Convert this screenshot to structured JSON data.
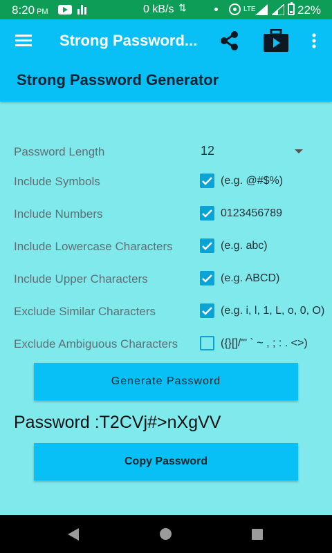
{
  "status_bar": {
    "time": "8:20",
    "ampm": "PM",
    "net_speed": "0 kB/s",
    "network_type": "LTE",
    "battery": "22%"
  },
  "toolbar": {
    "title": "Strong Password...",
    "icons": [
      "menu-icon",
      "share-icon",
      "briefcase-play-icon",
      "more-vert-icon"
    ]
  },
  "header": {
    "title": "Strong Password Generator"
  },
  "options": {
    "length": {
      "label": "Password Length",
      "value": "12"
    },
    "symbols": {
      "label": "Include Symbols",
      "hint": "(e.g. @#$%)",
      "checked": true
    },
    "numbers": {
      "label": "Include Numbers",
      "hint": "0123456789",
      "checked": true
    },
    "lowercase": {
      "label": "Include Lowercase Characters",
      "hint": "(e.g. abc)",
      "checked": true
    },
    "uppercase": {
      "label": "Include Upper Characters",
      "hint": "(e.g. ABCD)",
      "checked": true
    },
    "similar": {
      "label": "Exclude Similar Characters",
      "hint": "(e.g. i, l, 1, L, o, 0, O)",
      "checked": true
    },
    "ambiguous": {
      "label": "Exclude Ambiguous Characters",
      "hint": "({}[]/'\" ` ~ , ; : . <>)",
      "checked": false
    }
  },
  "actions": {
    "generate_label": "Generate Password",
    "copy_label": "Copy Password"
  },
  "result": {
    "password_text": "Password :T2CVj#>nXgVV"
  },
  "colors": {
    "status_bar": "#0E9D57",
    "accent": "#08C0F6",
    "background": "#7FE9EC",
    "checkbox": "#0AA3D6"
  }
}
